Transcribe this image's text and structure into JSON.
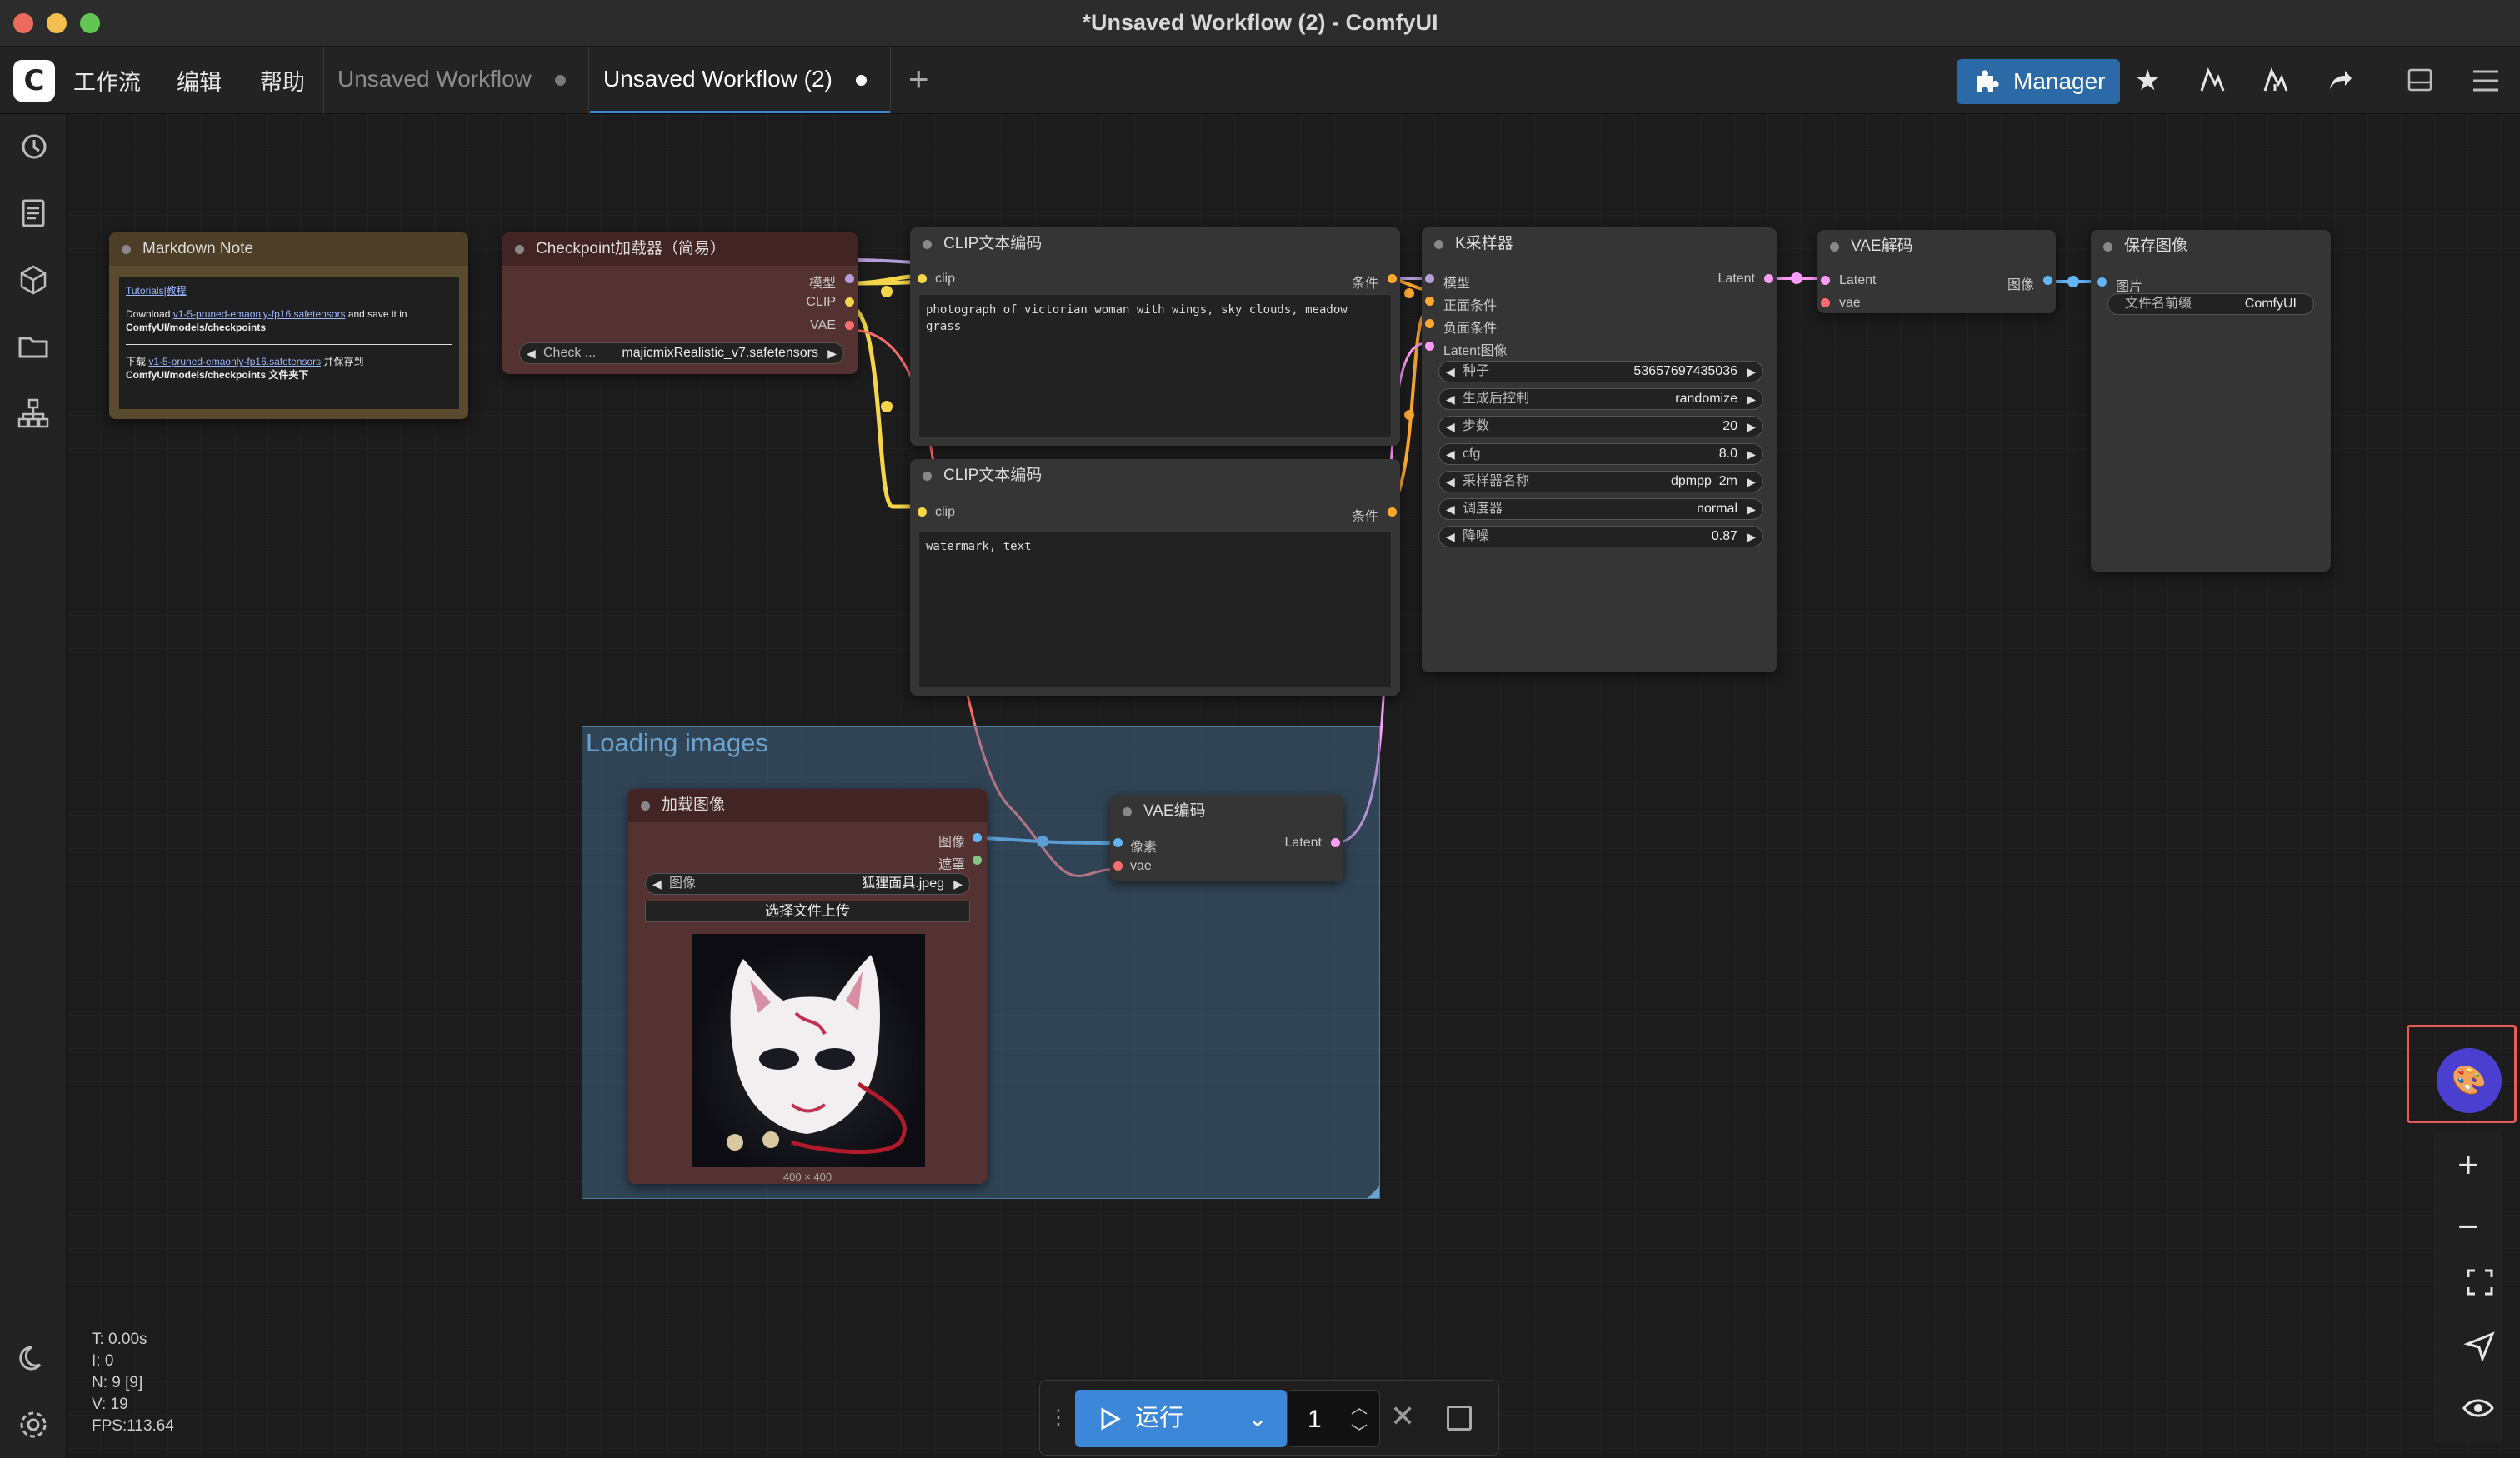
{
  "window": {
    "title": "*Unsaved Workflow (2) - ComfyUI",
    "traffic_colors": [
      "#ed6a5e",
      "#f5bf4f",
      "#62c554"
    ]
  },
  "menu": {
    "items": [
      "工作流",
      "编辑",
      "帮助"
    ]
  },
  "tabs": [
    {
      "label": "Unsaved Workflow",
      "active": false
    },
    {
      "label": "Unsaved Workflow (2)",
      "active": true
    }
  ],
  "toolbar": {
    "manager_label": "Manager",
    "add_tab": "+"
  },
  "nodes": {
    "markdown": {
      "title": "Markdown Note",
      "link1": "Tutorials|教程",
      "line1_a": "Download ",
      "line1_link": "v1-5-pruned-emaonly-fp16.safetensors",
      "line1_b": " and save it in",
      "line1_path": "ComfyUI/models/checkpoints",
      "line2_a": "下载 ",
      "line2_link": "v1-5-pruned-emaonly-fp16.safetensors",
      "line2_b": " 并保存到",
      "line2_path": "ComfyUI/models/checkpoints 文件夹下"
    },
    "checkpoint": {
      "title": "Checkpoint加载器（简易）",
      "outputs": [
        "模型",
        "CLIP",
        "VAE"
      ],
      "widget_label": "Check ...",
      "widget_value": "majicmixRealistic_v7.safetensors"
    },
    "clip_pos": {
      "title": "CLIP文本编码",
      "input": "clip",
      "output": "条件",
      "text": "photograph of victorian woman with wings, sky clouds, meadow grass"
    },
    "clip_neg": {
      "title": "CLIP文本编码",
      "input": "clip",
      "output": "条件",
      "text": "watermark, text"
    },
    "ksampler": {
      "title": "K采样器",
      "inputs": [
        "模型",
        "正面条件",
        "负面条件",
        "Latent图像"
      ],
      "output": "Latent",
      "widgets": [
        {
          "label": "种子",
          "value": "53657697435036"
        },
        {
          "label": "生成后控制",
          "value": "randomize"
        },
        {
          "label": "步数",
          "value": "20"
        },
        {
          "label": "cfg",
          "value": "8.0"
        },
        {
          "label": "采样器名称",
          "value": "dpmpp_2m"
        },
        {
          "label": "调度器",
          "value": "normal"
        },
        {
          "label": "降噪",
          "value": "0.87"
        }
      ]
    },
    "vae_decode": {
      "title": "VAE解码",
      "inputs": [
        "Latent",
        "vae"
      ],
      "output": "图像"
    },
    "save_image": {
      "title": "保存图像",
      "input": "图片",
      "widget_label": "文件名前缀",
      "widget_value": "ComfyUI"
    },
    "load_image": {
      "title": "加载图像",
      "outputs": [
        "图像",
        "遮罩"
      ],
      "widget_label": "图像",
      "widget_value": "狐狸面具.jpeg",
      "upload_label": "选择文件上传",
      "image_size": "400 × 400"
    },
    "vae_encode": {
      "title": "VAE编码",
      "inputs": [
        "像素",
        "vae"
      ],
      "output": "Latent"
    }
  },
  "group": {
    "title": "Loading images"
  },
  "run": {
    "label": "运行",
    "count": "1"
  },
  "stats": [
    "T: 0.00s",
    "I: 0",
    "N: 9 [9]",
    "V: 19",
    "FPS:113.64"
  ],
  "icons": {
    "sidebar": [
      "history-icon",
      "document-icon",
      "cube-icon",
      "folder-icon",
      "node-tree-icon"
    ],
    "sidebar_bottom": [
      "moon-icon",
      "settings-icon"
    ]
  },
  "colors": {
    "clip": "#f5d64b",
    "model": "#b39ddb",
    "vae": "#ff6e6e",
    "conditioning": "#ffa931",
    "latent": "#ff9cf9",
    "image": "#64b5f6",
    "mask": "#81c784",
    "accent": "#3d87d8"
  }
}
